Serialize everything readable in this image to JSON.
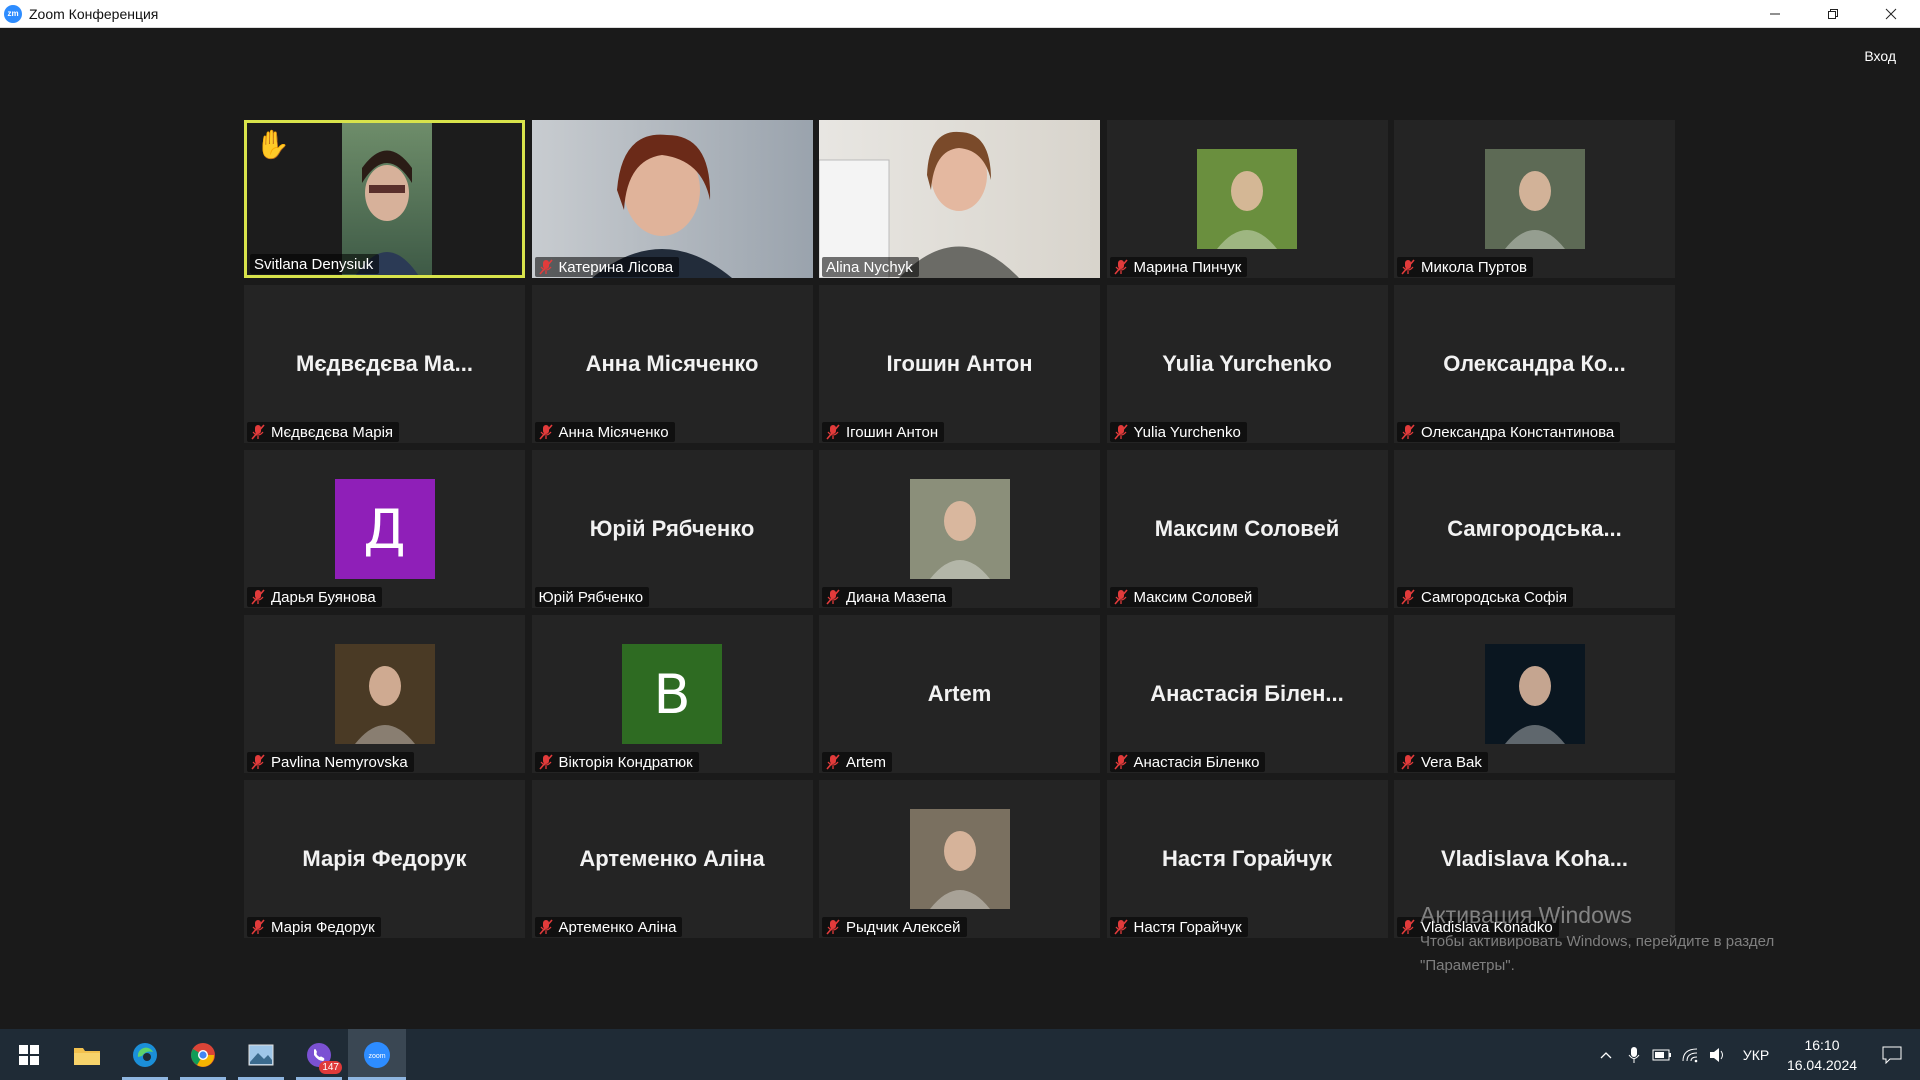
{
  "window": {
    "title": "Zoom Конференция",
    "login_label": "Вход"
  },
  "tiles": [
    {
      "name": "Svitlana Denysiuk",
      "kind": "video",
      "muted": false,
      "speaking": true,
      "hand": true,
      "bg": "#5a7a5a"
    },
    {
      "name": "Катерина Лісова",
      "kind": "video",
      "muted": true,
      "bg": "#9aa0a8"
    },
    {
      "name": "Alina Nychyk",
      "kind": "video",
      "muted": false,
      "bg": "#c9c4bc"
    },
    {
      "name": "Марина Пинчук",
      "kind": "photo",
      "muted": true,
      "bg": "#6a8f3e"
    },
    {
      "name": "Микола Пуртов",
      "kind": "photo",
      "muted": true,
      "bg": "#5d6a55"
    },
    {
      "name": "Мєдвєдєва Марія",
      "display": "Мєдвєдєва Ма...",
      "kind": "text",
      "muted": true
    },
    {
      "name": "Анна Місяченко",
      "display": "Анна Місяченко",
      "kind": "text",
      "muted": true
    },
    {
      "name": "Ігошин Антон",
      "display": "Ігошин Антон",
      "kind": "text",
      "muted": true
    },
    {
      "name": "Yulia Yurchenko",
      "display": "Yulia Yurchenko",
      "kind": "text",
      "muted": true
    },
    {
      "name": "Олександра Константинова",
      "display": "Олександра Ко...",
      "kind": "text",
      "muted": true
    },
    {
      "name": "Дарья Буянова",
      "kind": "letter",
      "letter": "Д",
      "color": "#8f1fb8",
      "muted": true
    },
    {
      "name": "Юрій Рябченко",
      "display": "Юрій Рябченко",
      "kind": "text",
      "muted": false
    },
    {
      "name": "Диана Мазепа",
      "kind": "photo",
      "muted": true,
      "bg": "#8b8f7a"
    },
    {
      "name": "Максим Соловей",
      "display": "Максим Соловей",
      "kind": "text",
      "muted": true
    },
    {
      "name": "Самгородська Софія",
      "display": "Самгородська...",
      "kind": "text",
      "muted": true
    },
    {
      "name": "Pavlina Nemyrovska",
      "kind": "photo",
      "muted": true,
      "bg": "#4a3a25"
    },
    {
      "name": "Вікторія Кондратюк",
      "kind": "letter",
      "letter": "В",
      "color": "#2e6b22",
      "muted": true
    },
    {
      "name": "Artem",
      "display": "Artem",
      "kind": "text",
      "muted": true
    },
    {
      "name": "Анастасія Біленко",
      "display": "Анастасія Білен...",
      "kind": "text",
      "muted": true
    },
    {
      "name": "Vera Bak",
      "kind": "photo",
      "muted": true,
      "bg": "#0a1620"
    },
    {
      "name": "Марія Федорук",
      "display": "Марія Федорук",
      "kind": "text",
      "muted": true
    },
    {
      "name": "Артеменко Аліна",
      "display": "Артеменко Аліна",
      "kind": "text",
      "muted": true
    },
    {
      "name": "Рыдчик Алексей",
      "kind": "photo",
      "muted": true,
      "bg": "#7a7060"
    },
    {
      "name": "Настя Горайчук",
      "display": "Настя Горайчук",
      "kind": "text",
      "muted": true
    },
    {
      "name": "Vladislava Konadko",
      "display": "Vladislava  Koha...",
      "kind": "text",
      "muted": true
    }
  ],
  "watermark": {
    "title": "Активация Windows",
    "line1": "Чтобы активировать Windows, перейдите в раздел",
    "line2": "\"Параметры\"."
  },
  "taskbar": {
    "apps": [
      {
        "name": "start-button",
        "icon": "windows-logo-icon"
      },
      {
        "name": "file-explorer",
        "icon": "folder-icon"
      },
      {
        "name": "edge-browser",
        "icon": "edge-icon"
      },
      {
        "name": "chrome-browser",
        "icon": "chrome-icon"
      },
      {
        "name": "photos-app",
        "icon": "photos-icon"
      },
      {
        "name": "viber-app",
        "icon": "viber-icon",
        "badge": "147"
      },
      {
        "name": "zoom-app",
        "icon": "zoom-icon",
        "label": "zoom"
      }
    ],
    "language": "УКР",
    "time": "16:10",
    "date": "16.04.2024"
  },
  "colors": {
    "background": "#1a1a1a",
    "tile": "#242424",
    "speaking_border": "#d8e34b",
    "mute_icon": "#e23b3b",
    "taskbar": "#1f2b36"
  }
}
